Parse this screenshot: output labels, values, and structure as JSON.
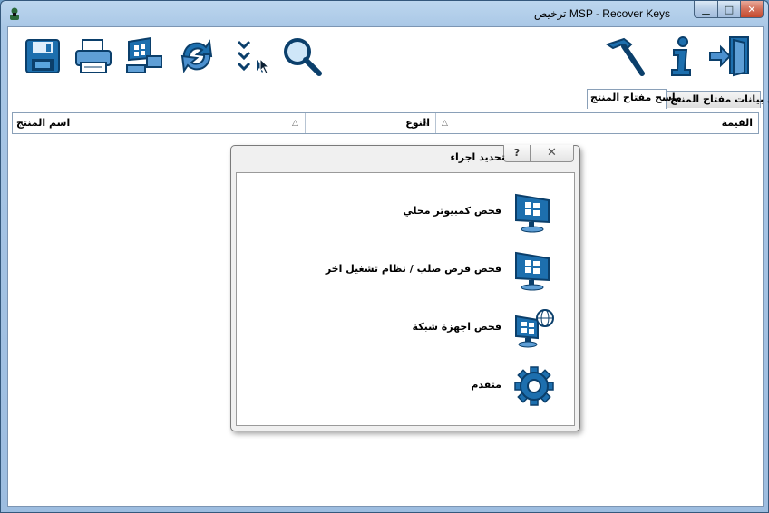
{
  "window": {
    "title": "ترخيص MSP - Recover Keys",
    "minimize": "▁",
    "maximize": "□",
    "close": "✕"
  },
  "toolbar": {
    "items": [
      "save-icon",
      "print-icon",
      "network-computer-icon",
      "refresh-icon",
      "checklist-icon",
      "search-icon",
      "hammer-icon",
      "info-icon",
      "exit-door-icon"
    ]
  },
  "tabs": [
    {
      "label": "قواعد بيانات مفتاح المنتج"
    },
    {
      "label": "ماسح مفتاح المنتج"
    }
  ],
  "grid": {
    "columns": [
      {
        "label": "القيمة"
      },
      {
        "label": "النوع"
      },
      {
        "label": "اسم المنتج"
      }
    ],
    "sort_glyph": "△"
  },
  "dialog": {
    "title": "تحديد اجراء",
    "help": "?",
    "close": "✕",
    "options": [
      {
        "label": "فحص كمبيوتر محلي",
        "icon": "local-computer-icon"
      },
      {
        "label": "فحص قرص صلب / نظام تشغيل اخر",
        "icon": "hard-disk-os-icon"
      },
      {
        "label": "فحص اجهزة شبكة",
        "icon": "network-devices-icon"
      },
      {
        "label": "متقدم",
        "icon": "gear-icon"
      }
    ]
  },
  "colors": {
    "accent": "#1a6fb0",
    "icon_dark": "#0b3f6b",
    "title_bar": "#a9c7e6"
  }
}
